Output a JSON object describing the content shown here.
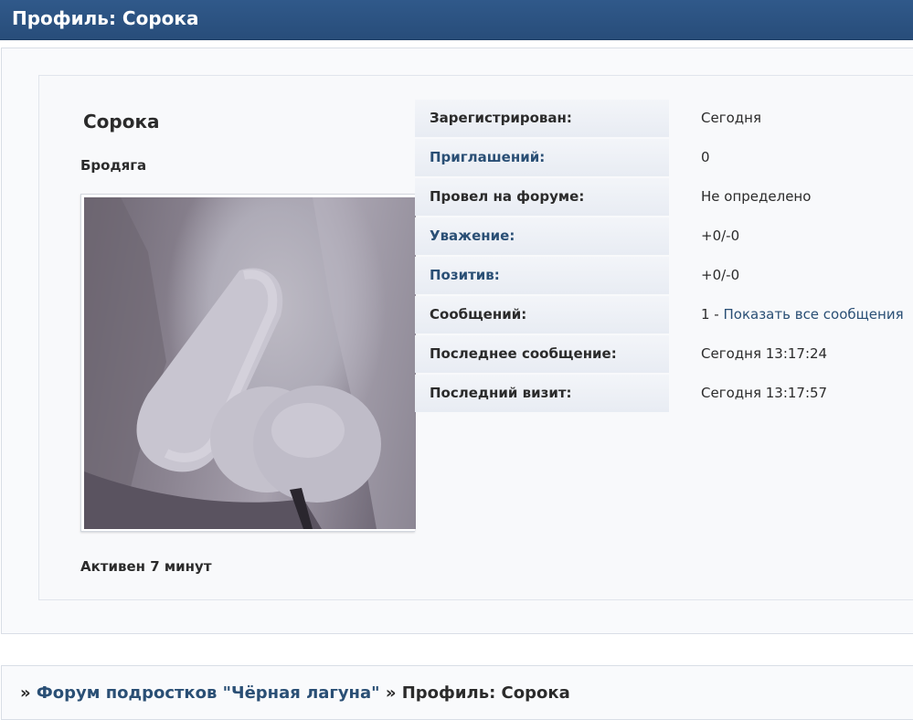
{
  "header": {
    "title": "Профиль: Сорока"
  },
  "profile": {
    "username": "Сорока",
    "usertitle": "Бродяга",
    "active": "Активен 7 минут"
  },
  "stats": [
    {
      "label": "Зарегистрирован:",
      "value": "Сегодня",
      "label_link": false
    },
    {
      "label": "Приглашений:",
      "value": "0",
      "label_link": true
    },
    {
      "label": "Провел на форуме:",
      "value": "Не определено",
      "label_link": false
    },
    {
      "label": "Уважение:",
      "value": "+0/-0",
      "label_link": true
    },
    {
      "label": "Позитив:",
      "value": "+0/-0",
      "label_link": true
    },
    {
      "label": "Сообщений:",
      "value_prefix": "1 - ",
      "value_link": "Показать все сообщения",
      "label_link": false
    },
    {
      "label": "Последнее сообщение:",
      "value": "Сегодня 13:17:24",
      "label_link": false
    },
    {
      "label": "Последний визит:",
      "value": "Сегодня 13:17:57",
      "label_link": false
    }
  ],
  "breadcrumb": {
    "sep": "»",
    "forum": "Форум подростков \"Чёрная лагуна\"",
    "current": "Профиль: Сорока"
  },
  "colors": {
    "header_bg": "#2c5282",
    "link": "#2a4f75",
    "label_bg": "#e8ecf3"
  }
}
